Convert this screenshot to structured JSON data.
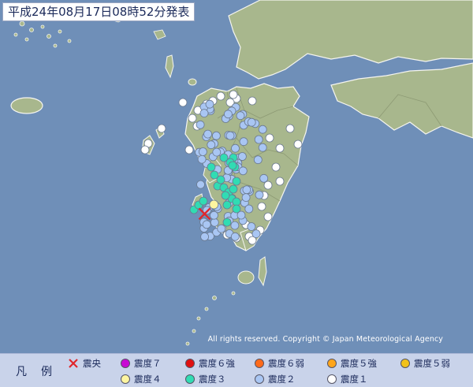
{
  "header": {
    "title": "平成24年08月17日08時52分発表"
  },
  "copyright": "All rights reserved. Copyright © Japan Meteorological Agency",
  "legend": {
    "title": "凡例",
    "epicenter": {
      "label": "震央",
      "color": "#e0262b"
    },
    "intensities": [
      {
        "label": "震度７",
        "color": "#c80ad4"
      },
      {
        "label": "震度６強",
        "color": "#e01010"
      },
      {
        "label": "震度６弱",
        "color": "#ff6a1a"
      },
      {
        "label": "震度５強",
        "color": "#ffa51a"
      },
      {
        "label": "震度５弱",
        "color": "#f2c21a"
      },
      {
        "label": "震度４",
        "color": "#fdf5a0"
      },
      {
        "label": "震度３",
        "color": "#31dcb3"
      },
      {
        "label": "震度２",
        "color": "#a9c6f3"
      },
      {
        "label": "震度１",
        "color": "#ffffff"
      }
    ]
  },
  "map_colors": {
    "sea": "#6f8fb8",
    "land": "#a8b78d",
    "coast": "#f5f5f0",
    "border": "#8d9a74"
  },
  "observations": {
    "epicenter": [
      {
        "lon": 130.25,
        "lat": 32.3
      }
    ],
    "shindo4": [
      {
        "lon": 130.35,
        "lat": 32.4
      }
    ]
  }
}
